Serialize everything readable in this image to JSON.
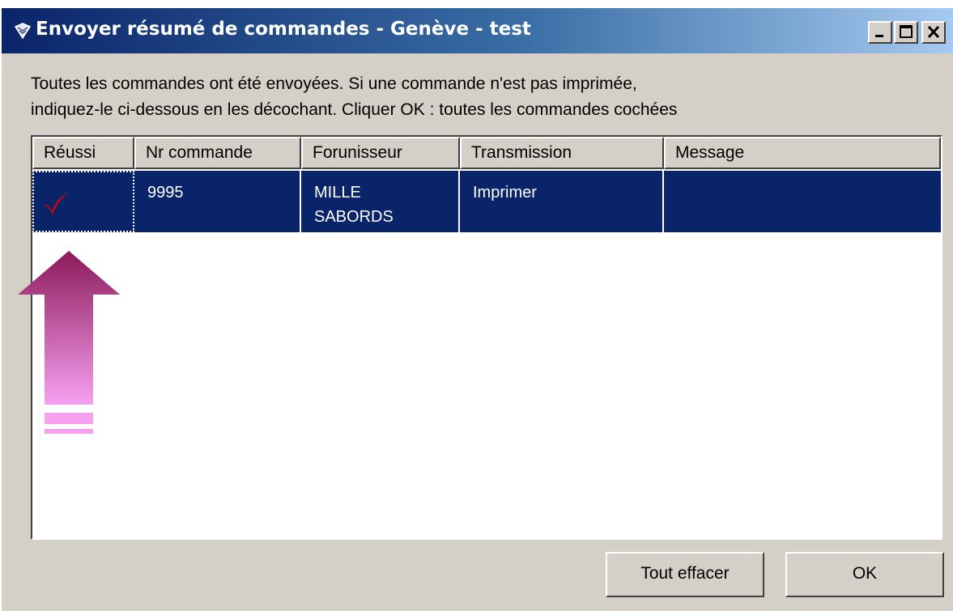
{
  "window": {
    "title": "Envoyer résumé de commandes - Genève - test",
    "title_icon": "app-icon",
    "controls": [
      "minimize-icon",
      "maximize-icon",
      "close-icon"
    ]
  },
  "instructions": {
    "line1": "Toutes les commandes ont été envoyées. Si une commande n'est pas imprimée,",
    "line2": "indiquez-le ci-dessous en les décochant. Cliquer OK : toutes les commandes cochées"
  },
  "table": {
    "columns": [
      "Réussi",
      "Nr commande",
      "Forunisseur",
      "Transmission",
      "Message"
    ],
    "rows": [
      {
        "success_icon": "checkmark-icon",
        "number": "9995",
        "supplier_line1": "MILLE",
        "supplier_line2": "SABORDS",
        "transmission": "Imprimer",
        "message": ""
      }
    ]
  },
  "buttons": {
    "clear": "Tout effacer",
    "ok": "OK"
  },
  "annotation": {
    "icon": "up-arrow-icon",
    "colors": [
      "#8b1a5a",
      "#f6a0f0"
    ]
  },
  "colors": {
    "selection": "#0a246a",
    "window_bg": "#d4d0c8",
    "check": "#e00000"
  }
}
